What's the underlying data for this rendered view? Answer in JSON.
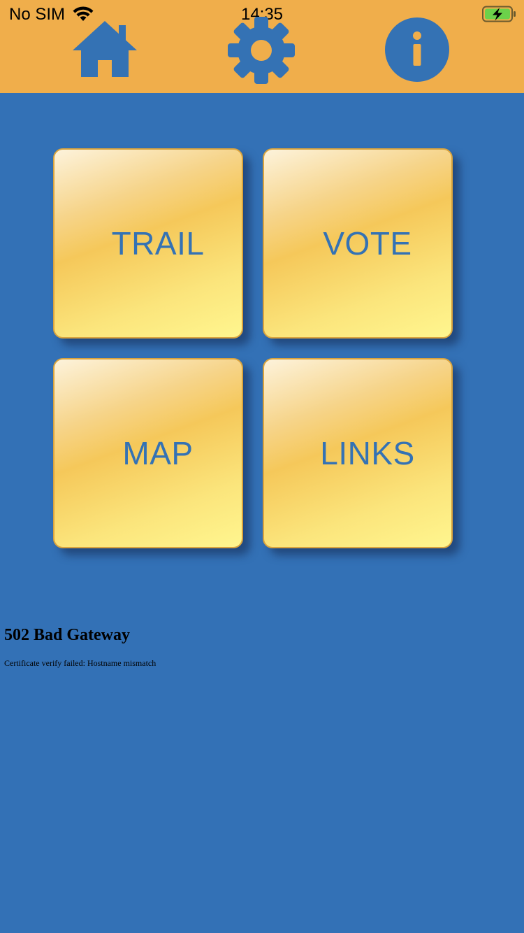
{
  "status_bar": {
    "carrier": "No SIM",
    "time": "14:35",
    "battery_state": "charging",
    "icons": [
      "wifi-icon",
      "battery-charging-icon"
    ]
  },
  "top_nav": {
    "background_color": "#f0ae4b",
    "icon_color": "#3472b4",
    "items": [
      {
        "name": "home",
        "icon": "home-icon"
      },
      {
        "name": "settings",
        "icon": "gear-icon"
      },
      {
        "name": "info",
        "icon": "info-icon"
      }
    ]
  },
  "main": {
    "background_color": "#3371b6",
    "tiles": [
      {
        "label": "TRAIL"
      },
      {
        "label": "VOTE"
      },
      {
        "label": "MAP"
      },
      {
        "label": "LINKS"
      }
    ]
  },
  "error": {
    "title": "502 Bad Gateway",
    "detail": "Certificate verify failed: Hostname mismatch"
  }
}
